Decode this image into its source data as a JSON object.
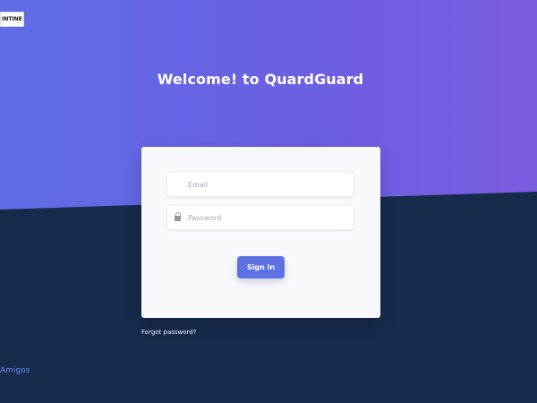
{
  "brand": {
    "badge_text": "INTINE"
  },
  "header": {
    "title": "Welcome! to QuardGuard"
  },
  "login": {
    "email_placeholder": "Email",
    "password_placeholder": "Password",
    "sign_in_label": "Sign in",
    "email_icon": "mail-icon",
    "password_icon": "lock-icon"
  },
  "links": {
    "forgot_password": "Forgot password?",
    "footer": "Amigos"
  },
  "colors": {
    "hero_start": "#5f6de6",
    "hero_end": "#7b5ce0",
    "navy_background": "#172b4d",
    "primary_button": "#5e72e4",
    "footer_link": "#6f87ff"
  }
}
